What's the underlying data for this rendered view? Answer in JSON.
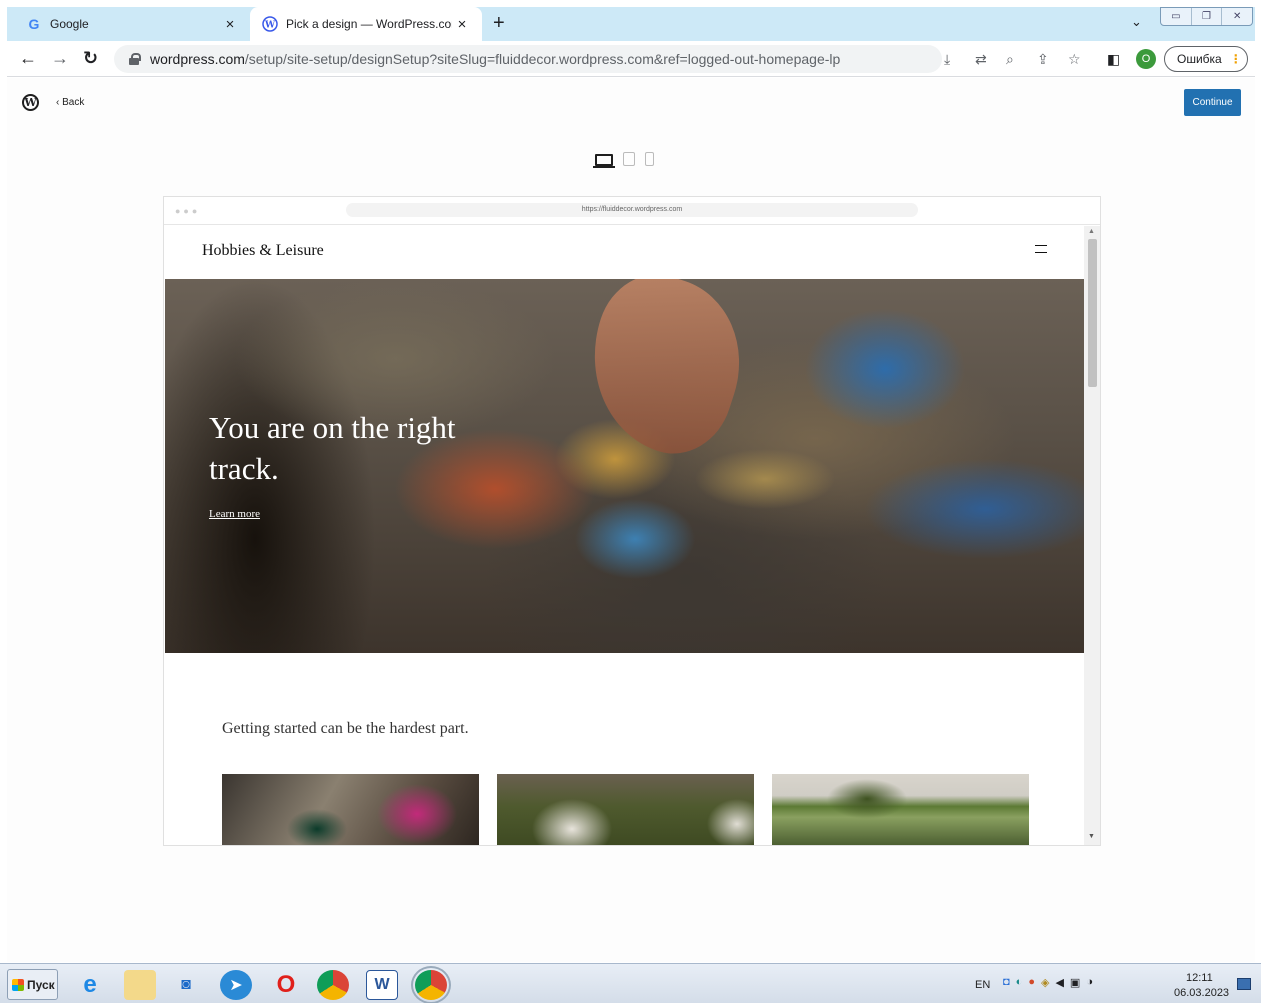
{
  "browser": {
    "tabs": [
      {
        "title": "Google",
        "close": "×"
      },
      {
        "title": "Pick a design — WordPress.com",
        "close": "×"
      }
    ],
    "new_tab": "+",
    "tab_search": "⌄",
    "url": {
      "domain": "wordpress.com",
      "rest": "/setup/site-setup/designSetup?siteSlug=fluiddecor.wordpress.com&ref=logged-out-homepage-lp"
    },
    "profile_initial": "O",
    "error_chip": "Ошибка"
  },
  "page": {
    "back_label": "Back",
    "continue_label": "Continue",
    "preview": {
      "url": "https://fluiddecor.wordpress.com",
      "site_title": "Hobbies & Leisure",
      "hero_heading": "You are on the right track.",
      "hero_link": "Learn more",
      "intro_text": "Getting started can be the hardest part."
    }
  },
  "taskbar": {
    "start_label": "Пуск",
    "language": "EN",
    "time": "12:11",
    "date": "06.03.2023"
  },
  "colors": {
    "accent": "#2271b1",
    "tab_strip": "#cde9f7"
  }
}
